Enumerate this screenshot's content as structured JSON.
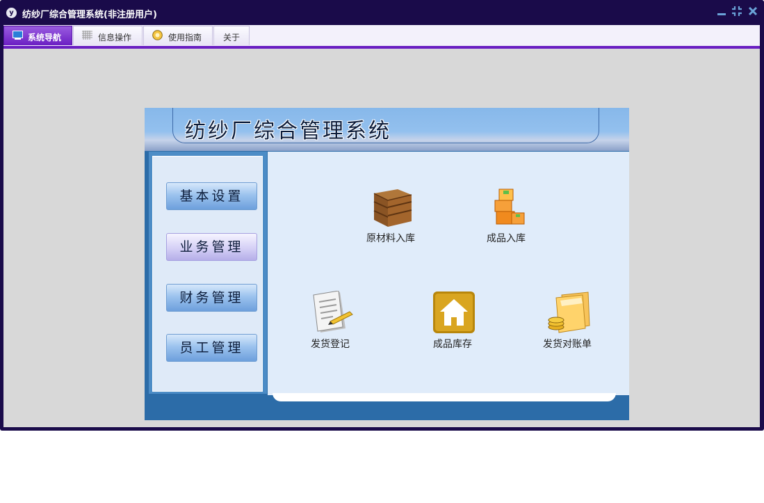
{
  "window": {
    "title": "纺纱厂综合管理系统(非注册用户)",
    "app_icon_glyph": "y"
  },
  "menu": {
    "tabs": [
      {
        "label": "系统导航",
        "icon": "monitor-icon",
        "active": true
      },
      {
        "label": "信息操作",
        "icon": "grid-icon",
        "active": false
      },
      {
        "label": "使用指南",
        "icon": "help-icon",
        "active": false
      },
      {
        "label": "关于",
        "icon": "",
        "active": false
      }
    ]
  },
  "panel": {
    "title": "纺纱厂综合管理系统"
  },
  "sidebar": {
    "items": [
      {
        "label": "基本设置",
        "active": false
      },
      {
        "label": "业务管理",
        "active": true
      },
      {
        "label": "财务管理",
        "active": false
      },
      {
        "label": "员工管理",
        "active": false
      }
    ]
  },
  "content": {
    "items": [
      {
        "label": "原材料入库",
        "icon": "wooden-crate-icon"
      },
      {
        "label": "成品入库",
        "icon": "stacked-boxes-icon"
      },
      {
        "label": "发货登记",
        "icon": "notepad-pencil-icon"
      },
      {
        "label": "成品库存",
        "icon": "house-icon"
      },
      {
        "label": "发货对账单",
        "icon": "folder-coins-icon"
      }
    ]
  },
  "colors": {
    "titlebar": "#1a0b4a",
    "accent": "#6a1fc2",
    "panel_blue": "#2c6ca8"
  }
}
